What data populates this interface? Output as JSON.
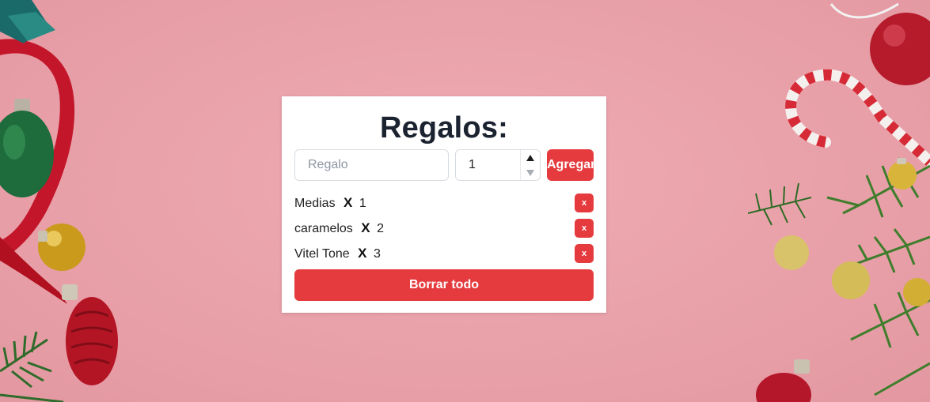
{
  "form": {
    "title": "Regalos:",
    "gift_placeholder": "Regalo",
    "gift_value": "",
    "quantity_value": "1",
    "add_label": "Agregar"
  },
  "gifts": [
    {
      "name": "Medias",
      "x": "X",
      "qty": "1",
      "delete_label": "x"
    },
    {
      "name": "caramelos",
      "x": "X",
      "qty": "2",
      "delete_label": "x"
    },
    {
      "name": "Vitel Tone",
      "x": "X",
      "qty": "3",
      "delete_label": "x"
    }
  ],
  "clear_label": "Borrar todo",
  "colors": {
    "background": "#e9a1a9",
    "accent": "#e53b3e",
    "title": "#1b2330"
  }
}
